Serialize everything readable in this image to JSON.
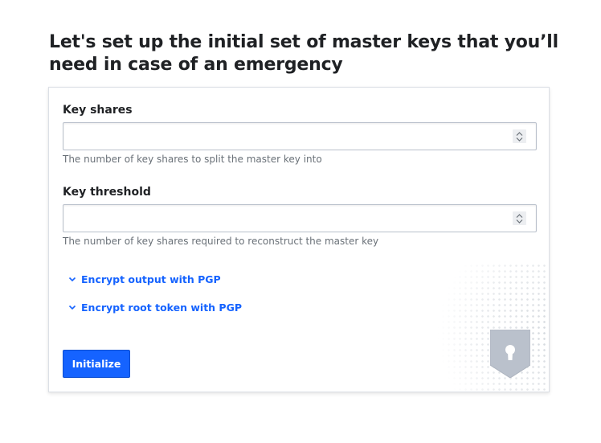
{
  "page": {
    "title": "Let's set up the initial set of master keys that you’ll need in case of an emergency"
  },
  "form": {
    "key_shares": {
      "label": "Key shares",
      "value": "",
      "help": "The number of key shares to split the master key into"
    },
    "key_threshold": {
      "label": "Key threshold",
      "value": "",
      "help": "The number of key shares required to reconstruct the master key"
    },
    "toggles": [
      {
        "label": "Encrypt output with PGP",
        "icon": "chevron-down-icon"
      },
      {
        "label": "Encrypt root token with PGP",
        "icon": "chevron-down-icon"
      }
    ],
    "submit_label": "Initialize"
  },
  "colors": {
    "accent": "#1563ff",
    "text": "#1f2124",
    "muted": "#6a7178",
    "border": "#bac1cc",
    "shield": "#bac1cc"
  },
  "icons": {
    "spinner": "stepper-arrows-icon",
    "illustration": "shield-keyhole-icon"
  }
}
